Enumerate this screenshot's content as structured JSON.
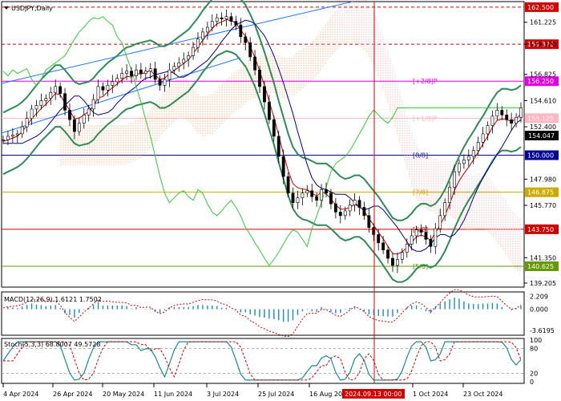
{
  "chart_data": [
    {
      "type": "candlestick",
      "title": "USDJPY,Daily",
      "ylim": [
        139.0,
        162.9
      ],
      "y_ticks": [
        "161.225",
        "159.370",
        "156.825",
        "154.610",
        "152.400",
        "147.980",
        "145.770",
        "141.350",
        "139.205"
      ],
      "x_ticks": [
        "4 Apr 2024",
        "26 Apr 2024",
        "20 May 2024",
        "11 Jun 2024",
        "3 Jul 2024",
        "25 Jul 2024",
        "16 Aug 2024",
        "1 Oct 2024",
        "23 Oct 2024"
      ],
      "crosshair_label": "2024.09.13 00:00",
      "current_price": "154.047",
      "murray_levels": [
        {
          "value": 162.5,
          "label": "162.500",
          "color": "#d40000",
          "style": "dashed"
        },
        {
          "value": 159.37,
          "label": "159.370",
          "color": "#d40000",
          "style": "dashed"
        },
        {
          "value": 156.25,
          "label": "156.250",
          "color": "#e100e1",
          "style": "solid",
          "text": "[+2/8]P"
        },
        {
          "value": 153.125,
          "label": "153.125",
          "color": "#ffb6c1",
          "style": "solid",
          "text": "[+1/8]P"
        },
        {
          "value": 150.0,
          "label": "150.000",
          "color": "#000099",
          "style": "solid",
          "text": "[8/8]"
        },
        {
          "value": 146.875,
          "label": "146.875",
          "color": "#ccaa00",
          "style": "solid",
          "text": "[7/8]"
        },
        {
          "value": 143.75,
          "label": "143.750",
          "color": "#cc0000",
          "style": "solid",
          "text": "[6/8]"
        },
        {
          "value": 140.625,
          "label": "140.625",
          "color": "#669900",
          "style": "solid",
          "text": "[5/8]"
        }
      ],
      "close_series": [
        151.3,
        151.6,
        151.7,
        151.8,
        152.4,
        153.1,
        153.9,
        154.2,
        154.6,
        154.8,
        155.3,
        155.8,
        155.2,
        153.8,
        153.0,
        152.0,
        152.7,
        153.4,
        153.9,
        154.7,
        155.8,
        155.5,
        155.9,
        156.2,
        156.5,
        156.9,
        157.1,
        156.7,
        157.2,
        156.9,
        157.1,
        157.3,
        156.4,
        155.9,
        156.4,
        157.2,
        157.5,
        157.8,
        158.1,
        158.4,
        159.1,
        159.8,
        160.4,
        160.8,
        161.3,
        161.6,
        161.5,
        161.7,
        161.3,
        161.0,
        160.0,
        159.5,
        158.3,
        157.2,
        155.8,
        154.5,
        153.0,
        151.6,
        149.9,
        148.2,
        146.8,
        146.0,
        146.4,
        146.8,
        147.0,
        146.5,
        146.2,
        147.1,
        146.8,
        145.9,
        145.2,
        144.9,
        145.3,
        145.8,
        146.2,
        145.6,
        144.9,
        143.9,
        143.3,
        142.6,
        142.0,
        141.3,
        140.7,
        141.2,
        141.8,
        142.5,
        143.2,
        143.7,
        143.5,
        142.9,
        142.3,
        143.8,
        144.9,
        146.0,
        147.3,
        148.6,
        149.3,
        149.6,
        149.9,
        150.4,
        151.1,
        151.8,
        152.5,
        153.3,
        153.8,
        153.4,
        153.0,
        152.7,
        153.2,
        154.0
      ],
      "ma_fast": [
        151.0,
        151.2,
        151.4,
        151.6,
        151.9,
        152.3,
        152.8,
        153.3,
        153.8,
        154.2,
        154.6,
        155.0,
        155.0,
        154.6,
        154.1,
        153.6,
        153.4,
        153.5,
        153.6,
        153.9,
        154.4,
        154.8,
        155.2,
        155.5,
        155.8,
        156.2,
        156.5,
        156.6,
        156.8,
        156.9,
        157.0,
        157.1,
        156.9,
        156.6,
        156.6,
        156.8,
        157.1,
        157.4,
        157.7,
        158.0,
        158.5,
        159.0,
        159.6,
        160.1,
        160.6,
        161.0,
        161.2,
        161.4,
        161.3,
        161.1,
        160.6,
        160.1,
        159.3,
        158.4,
        157.3,
        156.1,
        154.8,
        153.5,
        152.0,
        150.6,
        149.2,
        148.1,
        147.5,
        147.2,
        147.1,
        146.9,
        146.7,
        146.7,
        146.7,
        146.4,
        146.0,
        145.6,
        145.4,
        145.5,
        145.7,
        145.7,
        145.4,
        144.9,
        144.4,
        143.9,
        143.3,
        142.7,
        142.1,
        141.9,
        141.9,
        142.1,
        142.5,
        143.0,
        143.3,
        143.3,
        143.1,
        143.3,
        143.8,
        144.5,
        145.4,
        146.4,
        147.3,
        148.1,
        148.8,
        149.4,
        150.1,
        150.7,
        151.4,
        152.1,
        152.7,
        153.0,
        153.0,
        152.9,
        153.0,
        153.3
      ],
      "macd": {
        "label": "MACD(12,26,9) 1.6121 1.7502",
        "ylim": [
          -4.2,
          2.7
        ],
        "ticks": [
          "2.209",
          "0.000",
          "-3.6195"
        ]
      },
      "stoch": {
        "label": "Stoch(5,3,3) 68.8007 49.5728",
        "ylim": [
          0,
          100
        ],
        "ticks": [
          "100",
          "80",
          "20",
          "0"
        ]
      }
    }
  ]
}
